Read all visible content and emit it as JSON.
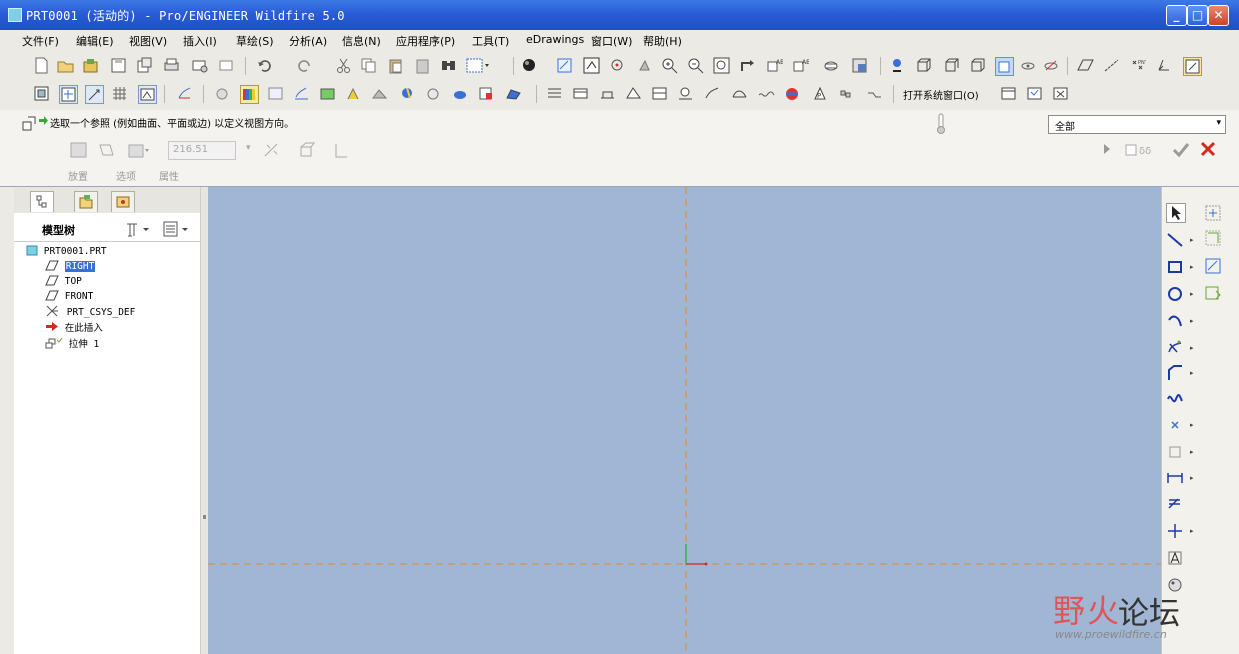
{
  "window": {
    "title": "PRT0001 (活动的) - Pro/ENGINEER Wildfire 5.0",
    "minimize_label": "_",
    "maximize_label": "□",
    "close_label": "✕"
  },
  "menu": [
    "文件(F)",
    "编辑(E)",
    "视图(V)",
    "插入(I)",
    "草绘(S)",
    "分析(A)",
    "信息(N)",
    "应用程序(P)",
    "工具(T)",
    "eDrawings",
    "窗口(W)",
    "帮助(H)"
  ],
  "toolbar": {
    "open_system_window": "打开系统窗口(O)"
  },
  "dashboard": {
    "prompt": "选取一个参照 (例如曲面、平面或边) 以定义视图方向。",
    "filter_value": "全部",
    "dimension_value": "216.51",
    "tabs": [
      "放置",
      "选项",
      "属性"
    ]
  },
  "model_tree": {
    "title": "模型树",
    "items": [
      {
        "label": "PRT0001.PRT",
        "icon": "part-icon",
        "selected": false,
        "indent": 0
      },
      {
        "label": "RIGHT",
        "icon": "datum-plane-icon",
        "selected": true,
        "indent": 1
      },
      {
        "label": "TOP",
        "icon": "datum-plane-icon",
        "selected": false,
        "indent": 1
      },
      {
        "label": "FRONT",
        "icon": "datum-plane-icon",
        "selected": false,
        "indent": 1
      },
      {
        "label": "PRT_CSYS_DEF",
        "icon": "csys-icon",
        "selected": false,
        "indent": 1
      },
      {
        "label": "在此插入",
        "icon": "insert-here-arrow-icon",
        "selected": false,
        "indent": 1
      },
      {
        "label": "拉伸 1",
        "icon": "extrude-icon",
        "selected": false,
        "indent": 1
      }
    ]
  },
  "watermark": {
    "brand_red": "野火",
    "brand_dark": "论坛",
    "url": "www.proewildfire.cn"
  },
  "colors": {
    "title_bar": "#2a5cd6",
    "graphics_bg": "#a1b6d4",
    "datum_axis": "#e08a30",
    "selection": "#3a6fd8"
  }
}
